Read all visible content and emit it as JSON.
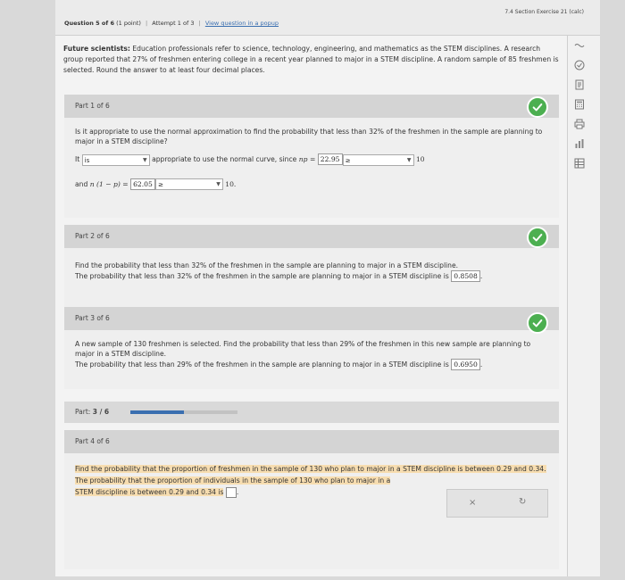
{
  "header": {
    "section_label": "7.4 Section Exercise 21 (calc)",
    "question": "Question 5 of 6",
    "points": "(1 point)",
    "attempt": "Attempt 1 of 3",
    "view_popup": "View question in a popup"
  },
  "intro": {
    "bold": "Future scientists:",
    "text": " Education professionals refer to science, technology, engineering, and mathematics as the STEM disciplines. A research group reported that 27% of freshmen entering college in a recent year planned to major in a STEM discipline. A random sample of 85 freshmen is selected. Round the answer to at least four decimal places."
  },
  "part1": {
    "title": "Part 1 of 6",
    "question": "Is it appropriate to use the normal approximation to find the probability that less than 32% of the freshmen in the sample are planning to major in a STEM discipline?",
    "it": "It",
    "is_value": "is",
    "appropriate_text": "appropriate to use the normal curve, since",
    "np": "np",
    "eq": "=",
    "np_value": "22.95",
    "ge": "≥",
    "ten": "10",
    "and_text": "and",
    "n1p": "n (1 − p)",
    "n1p_value": "62.05",
    "ten_dot": "10."
  },
  "part2": {
    "title": "Part 2 of 6",
    "question": "Find the probability that less than 32% of the freshmen in the sample are planning to major in a STEM discipline.",
    "answer_text": "The probability that less than 32% of the freshmen in the sample are planning to major in a STEM discipline is",
    "answer": "0.8508",
    "period": "."
  },
  "part3": {
    "title": "Part 3 of 6",
    "question": "A new sample of 130 freshmen is selected. Find the probability that less than 29% of the freshmen in this new sample are planning to major in a STEM discipline.",
    "answer_text": "The probability that less than 29% of the freshmen in the sample are planning to major in a STEM discipline is",
    "answer": "0.6950",
    "period": "."
  },
  "progress": {
    "prefix": "Part:",
    "value": "3 / 6"
  },
  "part4": {
    "title": "Part 4 of 6",
    "question": "Find the probability that the proportion of freshmen in the sample of 130 who plan to major in a STEM discipline is between 0.29 and 0.34.",
    "answer_line1": "The probability that the proportion of individuals in the sample of 130 who plan to major in a",
    "answer_line2": "STEM discipline is between 0.29 and 0.34 is",
    "period": ".",
    "clear_glyph": "×",
    "redo_glyph": "↻"
  },
  "toolbar": {
    "icons": [
      "reading-icon",
      "check-circle-icon",
      "notes-icon",
      "calculator-icon",
      "print-icon",
      "chart-icon",
      "table-icon"
    ]
  },
  "colors": {
    "check": "#4caf50",
    "highlight": "#f7ddb0",
    "progress_fill": "#3a6fb0"
  }
}
